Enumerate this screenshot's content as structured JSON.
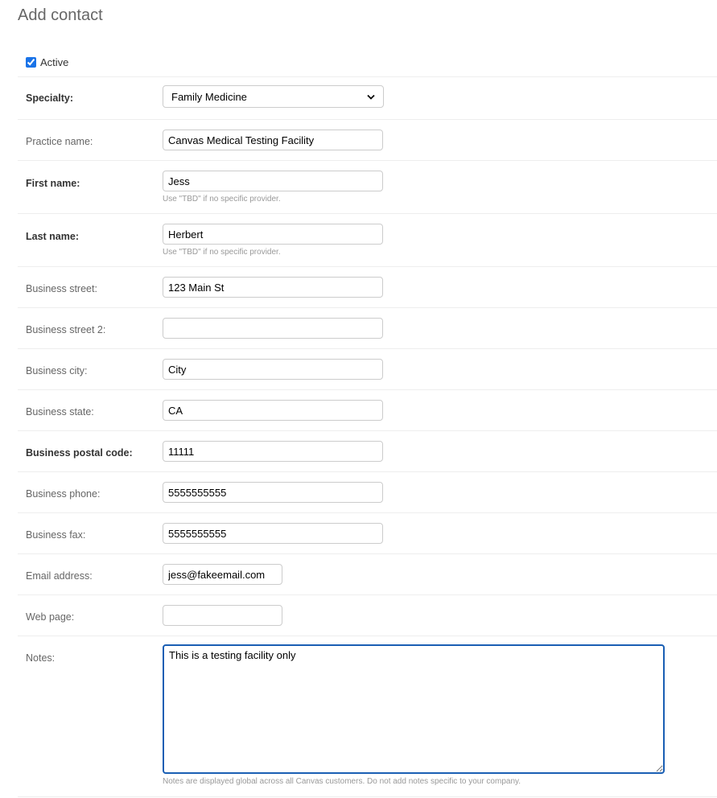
{
  "page": {
    "title": "Add contact"
  },
  "active": {
    "label": "Active",
    "checked": true
  },
  "help_texts": {
    "tbd": "Use \"TBD\" if no specific provider.",
    "notes": "Notes are displayed global across all Canvas customers. Do not add notes specific to your company."
  },
  "fields": {
    "specialty": {
      "label": "Specialty:",
      "value": "Family Medicine"
    },
    "practice_name": {
      "label": "Practice name:",
      "value": "Canvas Medical Testing Facility"
    },
    "first_name": {
      "label": "First name:",
      "value": "Jess"
    },
    "last_name": {
      "label": "Last name:",
      "value": "Herbert"
    },
    "business_street": {
      "label": "Business street:",
      "value": "123 Main St"
    },
    "business_street_2": {
      "label": "Business street 2:",
      "value": ""
    },
    "business_city": {
      "label": "Business city:",
      "value": "City"
    },
    "business_state": {
      "label": "Business state:",
      "value": "CA"
    },
    "business_postal_code": {
      "label": "Business postal code:",
      "value": "11111"
    },
    "business_phone": {
      "label": "Business phone:",
      "value": "5555555555"
    },
    "business_fax": {
      "label": "Business fax:",
      "value": "5555555555"
    },
    "email_address": {
      "label": "Email address:",
      "value": "jess@fakeemail.com"
    },
    "web_page": {
      "label": "Web page:",
      "value": ""
    },
    "notes": {
      "label": "Notes:",
      "value": "This is a testing facility only"
    }
  },
  "icons": {
    "select_arrow": "chevron-down-icon",
    "checkbox": "checkmark-icon"
  }
}
